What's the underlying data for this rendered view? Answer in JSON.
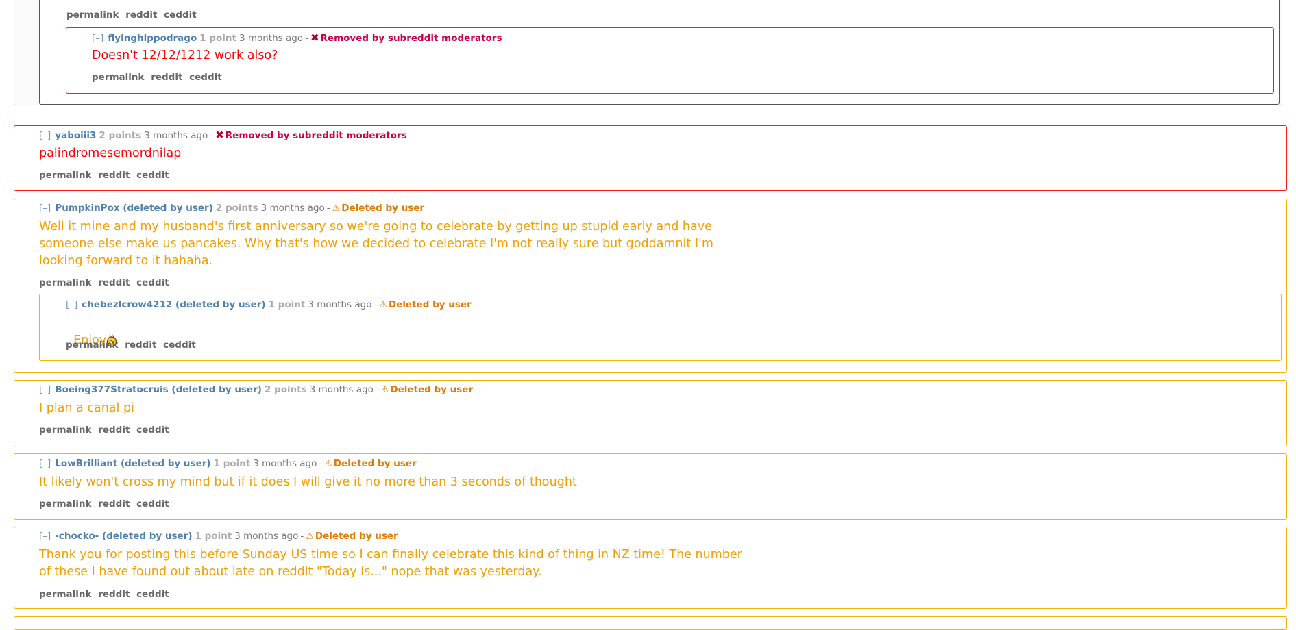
{
  "comments": {
    "top_links": [
      "permalink",
      "reddit",
      "ceddit"
    ],
    "c1": {
      "toggle": "[–]",
      "author": "flyinghippodrago",
      "points": "1 point",
      "time": "3 months ago",
      "status": "Removed by subreddit moderators",
      "body": "Doesn't 12/12/1212 work also?",
      "links": [
        "permalink",
        "reddit",
        "ceddit"
      ]
    },
    "c2": {
      "toggle": "[–]",
      "author": "yaboiii3",
      "points": "2 points",
      "time": "3 months ago",
      "status": "Removed by subreddit moderators",
      "body": "palindromesemordnilap",
      "links": [
        "permalink",
        "reddit",
        "ceddit"
      ]
    },
    "c3": {
      "toggle": "[–]",
      "author": "PumpkinPox (deleted by user)",
      "points": "2 points",
      "time": "3 months ago",
      "status": "Deleted by user",
      "body": "Well it mine and my husband's first anniversary so we're going to celebrate by getting up stupid early and have\nsomeone else make us pancakes. Why that's how we decided to celebrate I'm not really sure but goddamnit I'm\nlooking forward to it hahaha.",
      "links": [
        "permalink",
        "reddit",
        "ceddit"
      ]
    },
    "c4": {
      "toggle": "[–]",
      "author": "chebezlcrow4212 (deleted by user)",
      "points": "1 point",
      "time": "3 months ago",
      "status": "Deleted by user",
      "body": "Enjoy",
      "emoji": "ok-hand-emoji",
      "links": [
        "permalink",
        "reddit",
        "ceddit"
      ]
    },
    "c5": {
      "toggle": "[–]",
      "author": "Boeing377Stratocruis (deleted by user)",
      "points": "2 points",
      "time": "3 months ago",
      "status": "Deleted by user",
      "body": "I plan a canal pi",
      "links": [
        "permalink",
        "reddit",
        "ceddit"
      ]
    },
    "c6": {
      "toggle": "[–]",
      "author": "LowBrilliant (deleted by user)",
      "points": "1 point",
      "time": "3 months ago",
      "status": "Deleted by user",
      "body": "It likely won't cross my mind but if it does I will give it no more than 3 seconds of thought",
      "links": [
        "permalink",
        "reddit",
        "ceddit"
      ]
    },
    "c7": {
      "toggle": "[–]",
      "author": "-chocko- (deleted by user)",
      "points": "1 point",
      "time": "3 months ago",
      "status": "Deleted by user",
      "body": "Thank you for posting this before Sunday US time so I can finally celebrate this kind of thing in NZ time! The number\nof these I have found out about late on reddit \"Today is...\" nope that was yesterday.",
      "links": [
        "permalink",
        "reddit",
        "ceddit"
      ]
    }
  },
  "colors": {
    "removed_border": "#ff1a1a",
    "deleted_border": "#f5b400",
    "removed_text": "#ff0000",
    "deleted_text": "#f0a000",
    "author": "#4f7fad"
  },
  "icons": {
    "removed": "x-icon",
    "deleted": "warning-icon"
  }
}
